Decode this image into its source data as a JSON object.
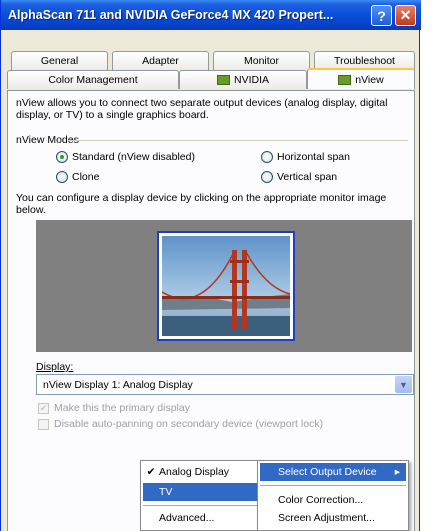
{
  "window": {
    "title": "AlphaScan 711 and NVIDIA GeForce4 MX 420 Propert...",
    "help_label": "?",
    "close_label": "✕"
  },
  "tabs": {
    "row1": [
      "General",
      "Adapter",
      "Monitor",
      "Troubleshoot"
    ],
    "row2": [
      "Color Management",
      "NVIDIA",
      "nView"
    ],
    "active": "nView"
  },
  "nview": {
    "description": "nView allows you to connect two separate output devices (analog display, digital display, or TV) to a single graphics board.",
    "modes_label": "nView Modes",
    "modes": [
      {
        "label": "Standard (nView disabled)",
        "selected": true
      },
      {
        "label": "Horizontal span",
        "selected": false
      },
      {
        "label": "Clone",
        "selected": false
      },
      {
        "label": "Vertical span",
        "selected": false
      }
    ],
    "configure_hint": "You can configure a display device by clicking on the appropriate monitor image below.",
    "display_label": "Display:",
    "display_value": "nView Display 1: Analog Display",
    "primary_checkbox": "Make this the primary display",
    "autopan_checkbox": "Disable auto-panning on secondary device (viewport lock)"
  },
  "context_menu": {
    "items": [
      {
        "label": "Analog Display",
        "checked": true
      },
      {
        "label": "TV",
        "highlighted": true
      },
      {
        "label": "Advanced..."
      }
    ],
    "checkmark": "✔"
  },
  "submenu": {
    "header": "Select Output Device",
    "arrow": "▸",
    "items": [
      "Color Correction...",
      "Screen Adjustment..."
    ]
  },
  "colors": {
    "titlebar": "#0a4fd9",
    "highlight": "#316ac5",
    "preview_bg": "#808080",
    "monitor_border": "#1e3ec8"
  }
}
